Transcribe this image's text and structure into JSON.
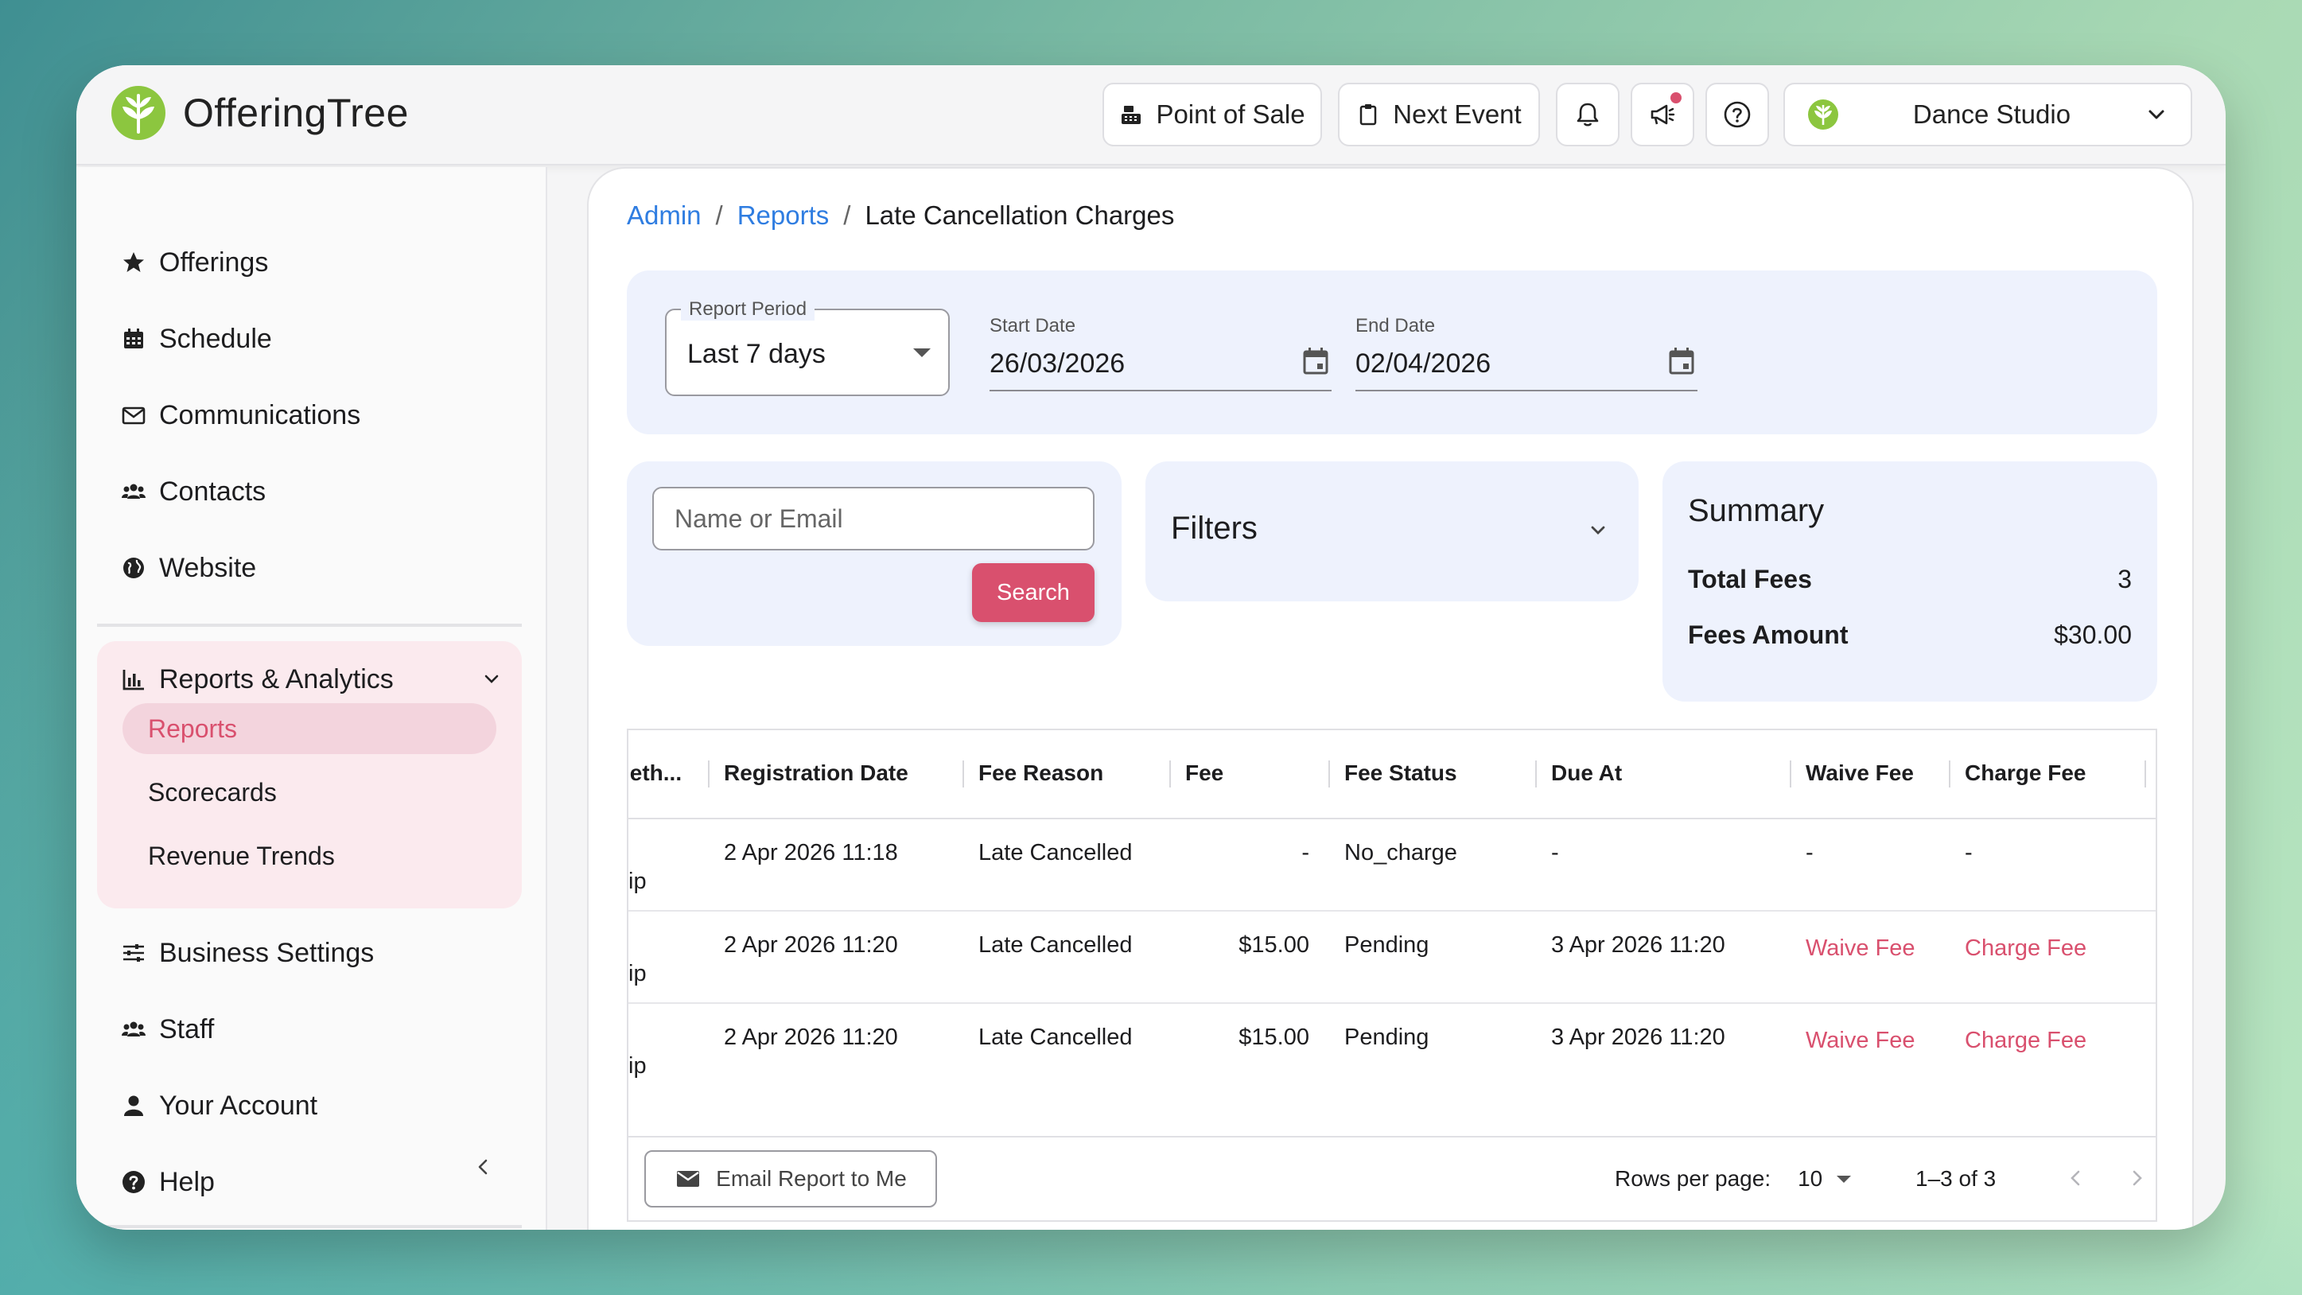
{
  "app": {
    "name": "OfferingTree"
  },
  "header": {
    "pos_label": "Point of Sale",
    "next_event_label": "Next Event",
    "studio_name": "Dance Studio"
  },
  "sidebar": {
    "items": [
      {
        "label": "Offerings",
        "icon": "star-icon"
      },
      {
        "label": "Schedule",
        "icon": "calendar-icon"
      },
      {
        "label": "Communications",
        "icon": "envelope-icon"
      },
      {
        "label": "Contacts",
        "icon": "users-icon"
      },
      {
        "label": "Website",
        "icon": "globe-icon"
      }
    ],
    "reports_group": {
      "label": "Reports & Analytics",
      "children": [
        {
          "label": "Reports",
          "active": true
        },
        {
          "label": "Scorecards",
          "active": false
        },
        {
          "label": "Revenue Trends",
          "active": false
        }
      ]
    },
    "bottom_items": [
      {
        "label": "Business Settings",
        "icon": "sliders-icon"
      },
      {
        "label": "Staff",
        "icon": "users-icon"
      },
      {
        "label": "Your Account",
        "icon": "user-icon"
      },
      {
        "label": "Help",
        "icon": "question-circle-icon"
      }
    ]
  },
  "breadcrumb": {
    "admin": "Admin",
    "reports": "Reports",
    "current": "Late Cancellation Charges",
    "sep": "/"
  },
  "period": {
    "label": "Report Period",
    "value": "Last 7 days",
    "start_label": "Start Date",
    "start_value": "26/03/2026",
    "end_label": "End Date",
    "end_value": "02/04/2026"
  },
  "search": {
    "placeholder": "Name or Email",
    "button": "Search"
  },
  "filters": {
    "title": "Filters"
  },
  "summary": {
    "title": "Summary",
    "total_fees_label": "Total Fees",
    "total_fees_value": "3",
    "fees_amount_label": "Fees Amount",
    "fees_amount_value": "$30.00"
  },
  "table": {
    "headers": {
      "method": "leth...",
      "registration_date": "Registration Date",
      "fee_reason": "Fee Reason",
      "fee": "Fee",
      "fee_status": "Fee Status",
      "due_at": "Due At",
      "waive_fee": "Waive Fee",
      "charge_fee": "Charge Fee"
    },
    "rows": [
      {
        "method": "ip",
        "registration_date": "2 Apr 2026 11:18",
        "fee_reason": "Late Cancelled",
        "fee": "-",
        "fee_status": "No_charge",
        "due_at": "-",
        "waive_fee": "-",
        "charge_fee": "-"
      },
      {
        "method": "ip",
        "registration_date": "2 Apr 2026 11:20",
        "fee_reason": "Late Cancelled",
        "fee": "$15.00",
        "fee_status": "Pending",
        "due_at": "3 Apr 2026 11:20",
        "waive_fee": "Waive Fee",
        "charge_fee": "Charge Fee"
      },
      {
        "method": "ip",
        "registration_date": "2 Apr 2026 11:20",
        "fee_reason": "Late Cancelled",
        "fee": "$15.00",
        "fee_status": "Pending",
        "due_at": "3 Apr 2026 11:20",
        "waive_fee": "Waive Fee",
        "charge_fee": "Charge Fee"
      }
    ]
  },
  "footer": {
    "email_button": "Email Report to Me",
    "rows_per_page_label": "Rows per page:",
    "rows_per_page_value": "10",
    "range": "1–3 of 3"
  },
  "colors": {
    "accent": "#d9506e",
    "link": "#2f7de1",
    "panel": "#eef2fd",
    "brand_green": "#8cc63f"
  }
}
